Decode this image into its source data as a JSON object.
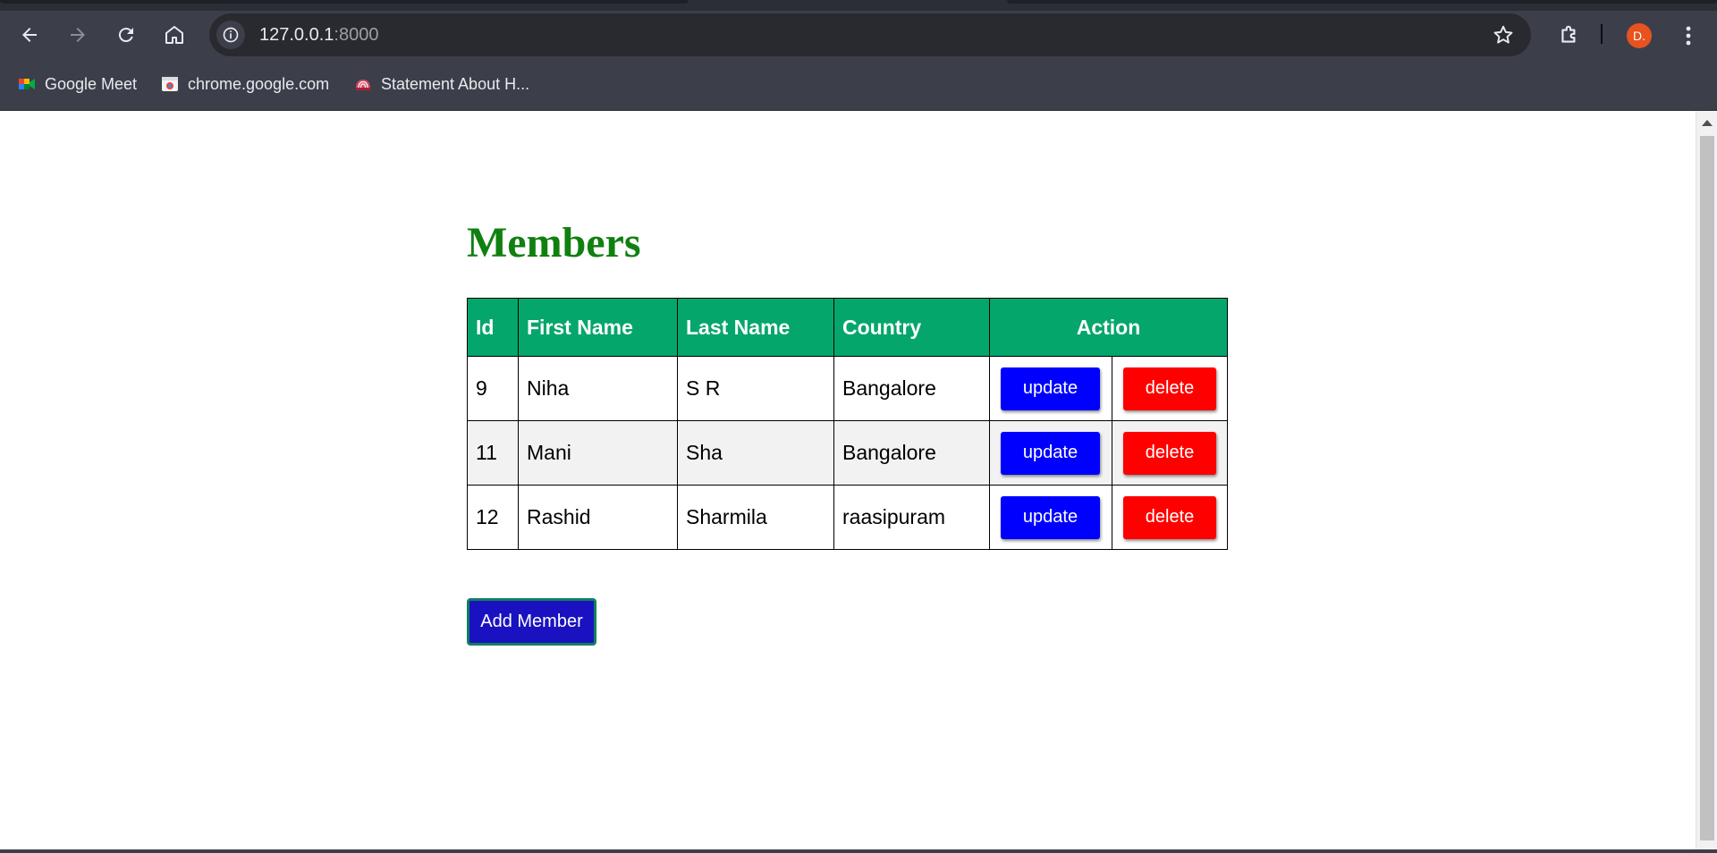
{
  "browser": {
    "address_bar": {
      "host": "127.0.0.1",
      "port": ":8000"
    },
    "profile_initial": "D.",
    "bookmarks": [
      {
        "label": "Google Meet",
        "icon": "google-meet-icon"
      },
      {
        "label": "chrome.google.com",
        "icon": "chrome-web-store-icon"
      },
      {
        "label": "Statement About H...",
        "icon": "emblem-icon"
      }
    ]
  },
  "page": {
    "title": "Members",
    "table": {
      "headers": [
        "Id",
        "First Name",
        "Last Name",
        "Country",
        "Action"
      ],
      "rows": [
        {
          "id": "9",
          "first_name": "Niha",
          "last_name": "S R",
          "country": "Bangalore"
        },
        {
          "id": "11",
          "first_name": "Mani",
          "last_name": "Sha",
          "country": "Bangalore"
        },
        {
          "id": "12",
          "first_name": "Rashid",
          "last_name": "Sharmila",
          "country": "raasipuram"
        }
      ],
      "update_label": "update",
      "delete_label": "delete"
    },
    "add_button": "Add Member"
  },
  "colors": {
    "title": "#108010",
    "header_bg": "#05a66b",
    "update_button": "#0000ff",
    "delete_button": "#ff0000",
    "add_button": "#1a12c0"
  }
}
